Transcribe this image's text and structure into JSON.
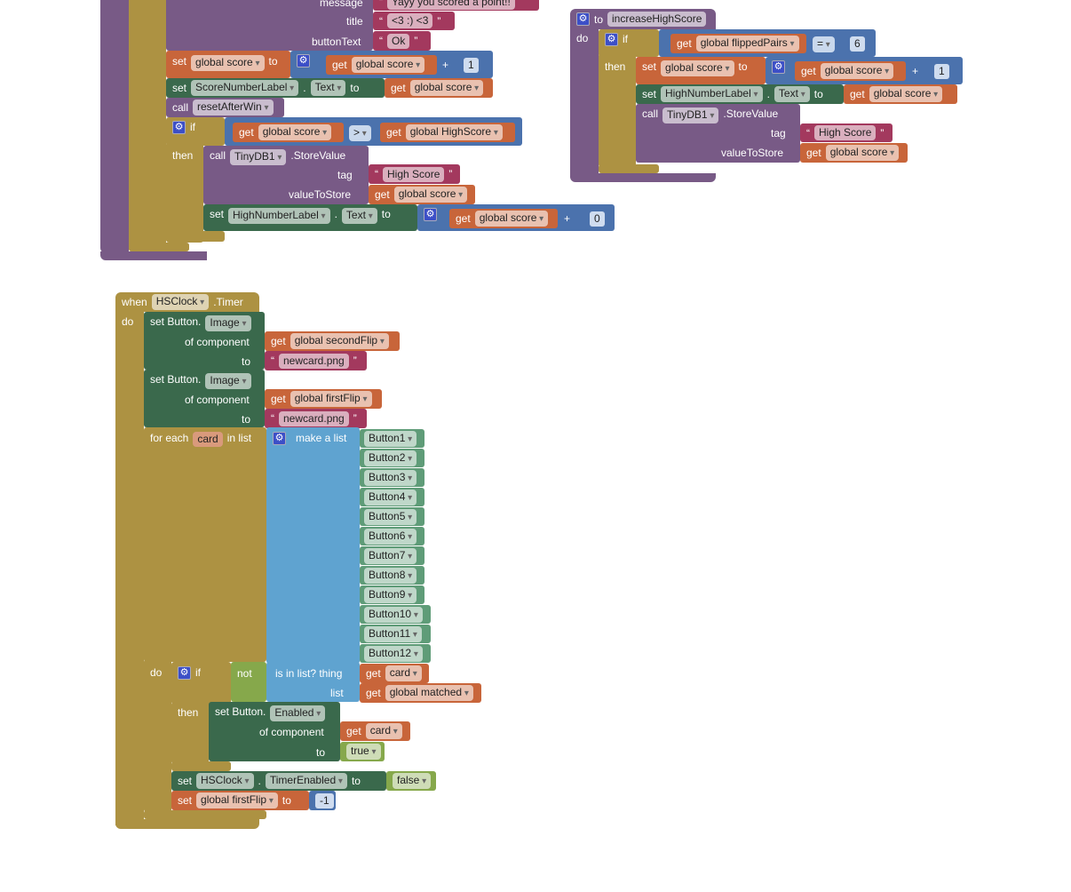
{
  "colors": {
    "procedure": "#785a86",
    "text": "#a3395e",
    "variable": "#c8653a",
    "component": "#3a694c",
    "math": "#4b72ad",
    "list": "#5fa3d0",
    "logic": "#86a84b",
    "control": "#ad9242",
    "component_item": "#5f9c78"
  },
  "w": {
    "set": "set",
    "to": "to",
    "get": "get",
    "call": "call",
    "if": "if",
    "then": "then",
    "do": "do",
    "plus": "+",
    "dot": ".",
    "qo": "“",
    "qc": "”",
    "when": "when",
    "not": "not"
  },
  "block1": {
    "message_label": "message",
    "message_value": "Yayy you scored a point!!",
    "title_label": "title",
    "title_value": "<3 :) <3",
    "button_label": "buttonText",
    "button_value": "Ok",
    "var_score": "global score",
    "one": "1",
    "label1": "ScoreNumberLabel",
    "prop_text": "Text",
    "proc": "resetAfterWin",
    "gt": ">",
    "var_high": "global HighScore",
    "db": "TinyDB1",
    "store": ".StoreValue",
    "tag_label": "tag",
    "tag_value": "High Score",
    "vts_label": "valueToStore",
    "label2": "HighNumberLabel",
    "zero": "0"
  },
  "block2": {
    "proc": "increaseHighScore",
    "var_pairs": "global flippedPairs",
    "eq": "=",
    "six": "6",
    "var_score": "global score",
    "one": "1",
    "label": "HighNumberLabel",
    "prop_text": "Text",
    "db": "TinyDB1",
    "store": ".StoreValue",
    "tag_label": "tag",
    "tag_value": "High Score",
    "vts_label": "valueToStore"
  },
  "block3": {
    "clock": "HSClock",
    "event": ".Timer",
    "set_button": "set Button.",
    "prop_image": "Image",
    "of_component": "of component",
    "var_second": "global secondFlip",
    "var_first": "global firstFlip",
    "png": "newcard.png",
    "for_each": "for each",
    "item": "card",
    "in_list": "in list",
    "make_list": "make a list",
    "buttons": [
      "Button1",
      "Button2",
      "Button3",
      "Button4",
      "Button5",
      "Button6",
      "Button7",
      "Button8",
      "Button9",
      "Button10",
      "Button11",
      "Button12"
    ],
    "is_in_list": "is in list? thing",
    "list_label": "list",
    "var_matched": "global matched",
    "prop_enabled": "Enabled",
    "true": "true",
    "prop_timer": "TimerEnabled",
    "false": "false",
    "minus_one": "-1"
  }
}
